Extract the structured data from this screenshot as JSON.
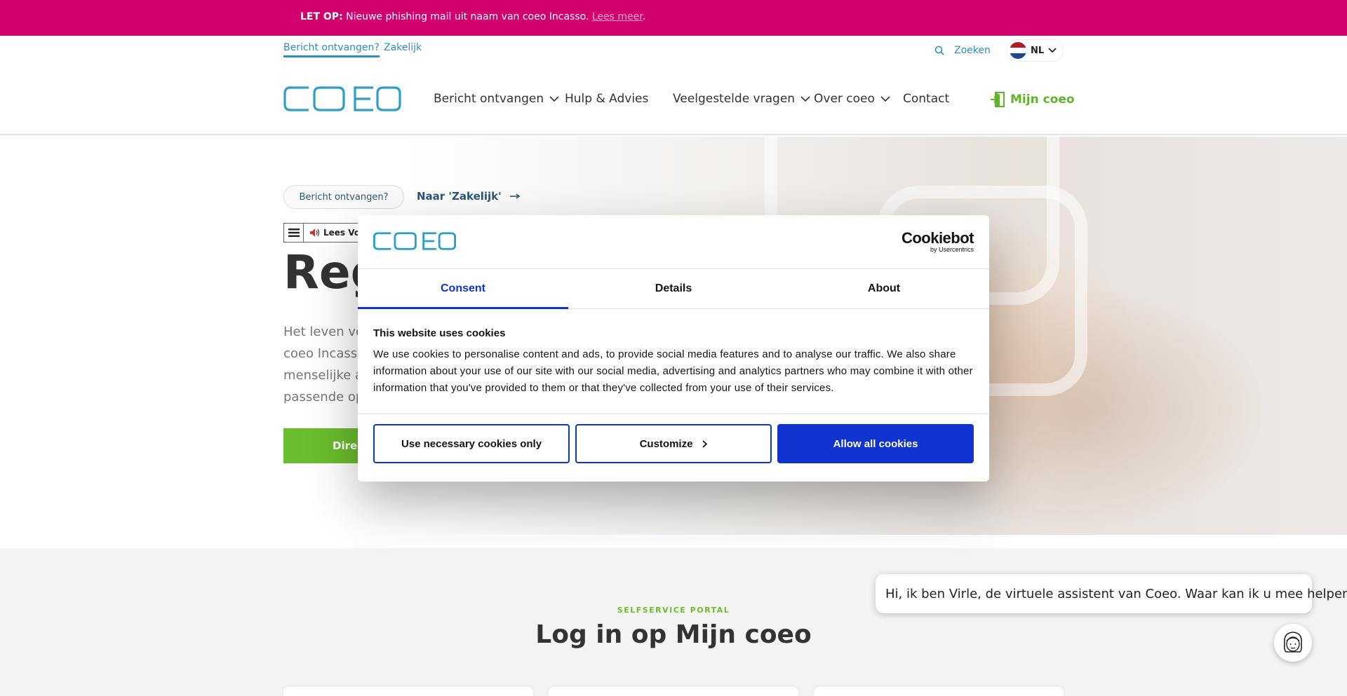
{
  "alert": {
    "prefix": "LET OP:",
    "message": " Nieuwe phishing mail uit naam van coeo Incasso. ",
    "link": "Lees meer",
    "suffix": "."
  },
  "topbar": {
    "links": [
      "Bericht ontvangen?",
      "Zakelijk"
    ],
    "search": "Zoeken",
    "language": "NL"
  },
  "nav": {
    "logo": "COEO",
    "items": [
      "Bericht ontvangen",
      "Hulp & Advies",
      "Veelgestelde vragen",
      "Over coeo",
      "Contact"
    ],
    "account": "Mijn coeo"
  },
  "hero": {
    "pill": "Bericht ontvangen?",
    "switch_link": "Naar 'Zakelijk'",
    "reader_label": "Lees Vo",
    "title": "Reg",
    "text_lines": [
      "Het leven ver",
      "coeo Incasso",
      "menselijke aa",
      "passende opl"
    ],
    "button": "Direc"
  },
  "portal": {
    "kicker": "SELFSERVICE PORTAL",
    "title": "Log in op Mijn coeo"
  },
  "chat": {
    "message": "Hi, ik ben Virle, de virtuele assistent van Coeo. Waar kan ik u mee helpen?"
  },
  "cookie": {
    "brand": "Cookiebot",
    "brand_sub": "by Usercentrics",
    "tabs": [
      "Consent",
      "Details",
      "About"
    ],
    "heading": "This website uses cookies",
    "body": "We use cookies to personalise content and ads, to provide social media features and to analyse our traffic. We also share information about your use of our site with our social media, advertising and analytics partners who may combine it with other information that you've provided to them or that they've collected from your use of their services.",
    "btn_necessary": "Use necessary cookies only",
    "btn_customize": "Customize",
    "btn_allow": "Allow all cookies"
  },
  "colors": {
    "alert": "#d1006f",
    "brand_blue": "#2e8fbf",
    "green": "#6abd2c",
    "cookie_blue": "#1032cf"
  }
}
